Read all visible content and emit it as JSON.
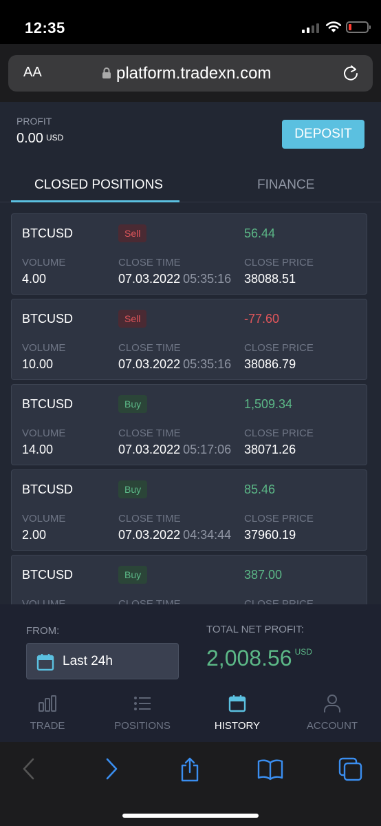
{
  "status": {
    "time": "12:35"
  },
  "browser": {
    "text_size_label": "AA",
    "url": "platform.tradexn.com"
  },
  "header": {
    "profit_label": "PROFIT",
    "profit_value": "0.00",
    "profit_unit": "USD",
    "deposit_label": "DEPOSIT"
  },
  "tabs": [
    {
      "label": "CLOSED POSITIONS",
      "active": true
    },
    {
      "label": "FINANCE",
      "active": false
    }
  ],
  "positions_labels": {
    "volume": "VOLUME",
    "close_time": "CLOSE TIME",
    "close_price": "CLOSE PRICE"
  },
  "positions": [
    {
      "symbol": "BTCUSD",
      "side": "Sell",
      "pl": "56.44",
      "pl_sign": "pos",
      "volume": "4.00",
      "date": "07.03.2022",
      "time": "05:35:16",
      "price": "38088.51"
    },
    {
      "symbol": "BTCUSD",
      "side": "Sell",
      "pl": "-77.60",
      "pl_sign": "neg",
      "volume": "10.00",
      "date": "07.03.2022",
      "time": "05:35:16",
      "price": "38086.79"
    },
    {
      "symbol": "BTCUSD",
      "side": "Buy",
      "pl": "1,509.34",
      "pl_sign": "pos",
      "volume": "14.00",
      "date": "07.03.2022",
      "time": "05:17:06",
      "price": "38071.26"
    },
    {
      "symbol": "BTCUSD",
      "side": "Buy",
      "pl": "85.46",
      "pl_sign": "pos",
      "volume": "2.00",
      "date": "07.03.2022",
      "time": "04:34:44",
      "price": "37960.19"
    },
    {
      "symbol": "BTCUSD",
      "side": "Buy",
      "pl": "387.00",
      "pl_sign": "pos",
      "volume": "",
      "date": "",
      "time": "",
      "price": ""
    }
  ],
  "footer": {
    "from_label": "FROM:",
    "from_value": "Last 24h",
    "net_label": "TOTAL NET PROFIT:",
    "net_value": "2,008.56",
    "net_unit": "USD"
  },
  "nav": [
    {
      "label": "TRADE",
      "icon": "bar-chart-icon",
      "active": false
    },
    {
      "label": "POSITIONS",
      "icon": "list-icon",
      "active": false
    },
    {
      "label": "HISTORY",
      "icon": "calendar-icon",
      "active": true
    },
    {
      "label": "ACCOUNT",
      "icon": "user-icon",
      "active": false
    }
  ],
  "colors": {
    "accent": "#5bc0e0",
    "positive": "#5cb887",
    "negative": "#e0565b",
    "background": "#222733"
  }
}
